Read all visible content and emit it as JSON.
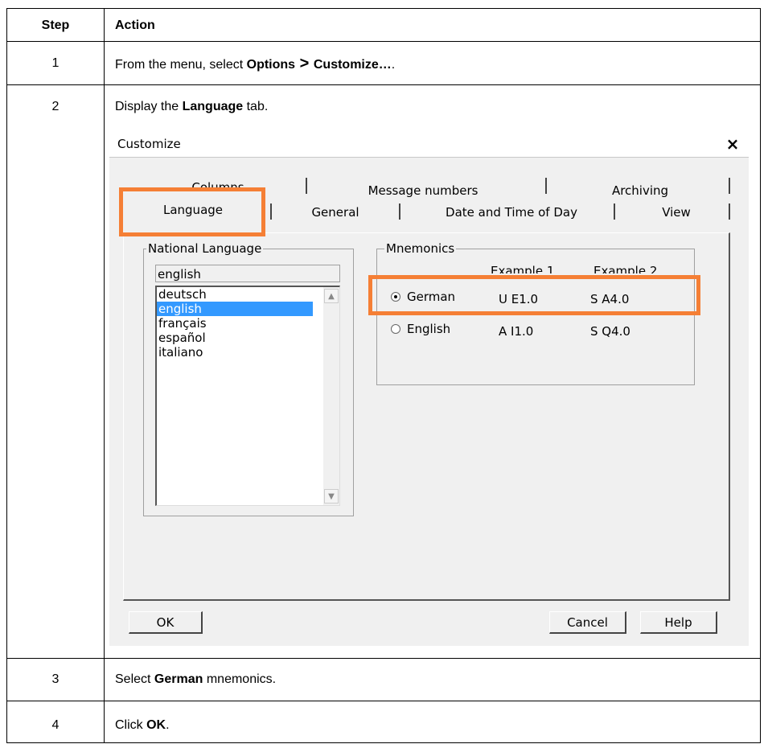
{
  "table": {
    "headers": {
      "step": "Step",
      "action": "Action"
    },
    "rows": [
      {
        "step": "1",
        "pre": "From the menu, select ",
        "bold1": "Options",
        "sep": " > ",
        "bold2": "Customize…",
        "post": "."
      },
      {
        "step": "2",
        "pre": "Display the ",
        "bold": "Language",
        "post": " tab."
      },
      {
        "step": "3",
        "pre": "Select ",
        "bold": "German",
        "post": " mnemonics."
      },
      {
        "step": "4",
        "pre": "Click ",
        "bold": "OK",
        "post": "."
      }
    ]
  },
  "dialog": {
    "title": "Customize",
    "close_label": "×",
    "tabs_back": [
      "Columns",
      "Message numbers",
      "Archiving"
    ],
    "tabs_front": [
      "Language",
      "General",
      "Date and Time of Day",
      "View"
    ],
    "active_tab": "Language",
    "national_language": {
      "legend": "National Language",
      "current": "english",
      "options": [
        "deutsch",
        "english",
        "français",
        "español",
        "italiano"
      ],
      "selected": "english"
    },
    "mnemonics": {
      "legend": "Mnemonics",
      "col1": "Example 1",
      "col2": "Example 2",
      "rows": [
        {
          "label": "German",
          "ex1": "U E1.0",
          "ex2": "S A4.0",
          "checked": true
        },
        {
          "label": "English",
          "ex1": "A I1.0",
          "ex2": "S Q4.0",
          "checked": false
        }
      ]
    },
    "buttons": {
      "ok": "OK",
      "cancel": "Cancel",
      "help": "Help"
    }
  },
  "highlight_color": "#f57f35",
  "selection_color": "#3399ff"
}
